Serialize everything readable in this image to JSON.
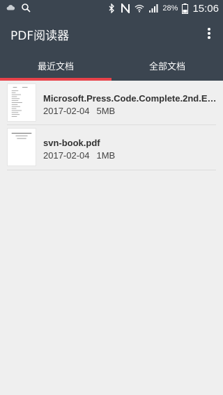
{
  "statusbar": {
    "battery_percent": "28%",
    "time": "15:06"
  },
  "appbar": {
    "title": "PDF阅读器",
    "menu_icon": "more-vert-icon"
  },
  "tabs": [
    {
      "label": "最近文档",
      "selected": true
    },
    {
      "label": "全部文档",
      "selected": false
    }
  ],
  "accent_color": "#e8424a",
  "header_color": "#3b4550",
  "documents": [
    {
      "name": "Microsoft.Press.Code.Complete.2nd.Edition...",
      "date": "2017-02-04",
      "size": "5MB"
    },
    {
      "name": "svn-book.pdf",
      "date": "2017-02-04",
      "size": "1MB"
    }
  ]
}
